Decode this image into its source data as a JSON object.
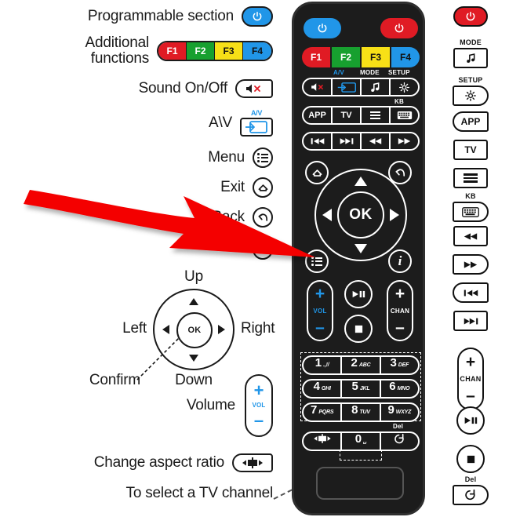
{
  "page": {
    "title": "Universal remote control button guide",
    "background": "#ffffff"
  },
  "colors": {
    "blue": "#2196e8",
    "red": "#e01b24",
    "green": "#17a02f",
    "yellow": "#f7e017",
    "remote_body": "#1c1c1c",
    "arrow_red": "#f40000",
    "text": "#1a1a1a"
  },
  "callouts": [
    {
      "label": "Programmable section",
      "icon": "power-icon"
    },
    {
      "label": "Additional functions",
      "label_line1": "Additional",
      "label_line2": "functions",
      "icon": "f-keys-strip"
    },
    {
      "label": "Sound On/Off",
      "icon": "mute-icon"
    },
    {
      "label": "A\\V",
      "icon": "av-input-icon",
      "tag": "A/V"
    },
    {
      "label": "Menu",
      "icon": "menu-list-icon"
    },
    {
      "label": "Exit",
      "icon": "exit-home-icon"
    },
    {
      "label": "Back",
      "icon": "back-arrow-icon"
    },
    {
      "label": "Volume",
      "icon": "volume-rocker"
    },
    {
      "label": "Change aspect ratio",
      "icon": "aspect-ratio-icon"
    },
    {
      "label": "To select a TV channel",
      "icon": "dashed-leader"
    }
  ],
  "function_keys": [
    {
      "label": "F1",
      "color": "#e01b24"
    },
    {
      "label": "F2",
      "color": "#17a02f"
    },
    {
      "label": "F3",
      "color": "#f7e017"
    },
    {
      "label": "F4",
      "color": "#2196e8"
    }
  ],
  "dpad_diagram": {
    "up": "Up",
    "down": "Down",
    "left": "Left",
    "right": "Right",
    "center": "OK",
    "confirm": "Confirm"
  },
  "volume_rocker": {
    "plus": "+",
    "label": "VOL",
    "minus": "–"
  },
  "remote": {
    "power_left": "power-icon",
    "power_right": "power-icon",
    "function_row": [
      "F1",
      "F2",
      "F3",
      "F4"
    ],
    "row_mute_av": {
      "tags": {
        "av": "A/V",
        "mode": "MODE",
        "setup": "SETUP"
      },
      "keys": [
        "mute-icon",
        "av-input-icon",
        "music-note-icon",
        "gear-icon"
      ]
    },
    "row_app": {
      "tags": {
        "kb": "KB"
      },
      "keys": [
        "APP",
        "TV",
        "hamburger-icon",
        "keyboard-icon"
      ]
    },
    "row_transport": [
      "skip-back-icon",
      "skip-forward-icon",
      "rewind-icon",
      "fast-forward-icon"
    ],
    "nav": {
      "home": "exit-home-icon",
      "back": "back-arrow-icon",
      "menu": "menu-list-icon",
      "info": "info-icon",
      "ok": "OK"
    },
    "vol": {
      "plus": "+",
      "label": "VOL",
      "minus": "–"
    },
    "chan": {
      "plus": "+",
      "label": "CHAN",
      "minus": "–"
    },
    "playpause": "play-pause-icon",
    "stop": "stop-icon",
    "keypad": [
      {
        "num": "1",
        "sub": ".,!/"
      },
      {
        "num": "2",
        "sub": "ABC"
      },
      {
        "num": "3",
        "sub": "DEF"
      },
      {
        "num": "4",
        "sub": "GHI"
      },
      {
        "num": "5",
        "sub": "JKL"
      },
      {
        "num": "6",
        "sub": "MNO"
      },
      {
        "num": "7",
        "sub": "PQRS"
      },
      {
        "num": "8",
        "sub": "TUV"
      },
      {
        "num": "9",
        "sub": "WXYZ"
      }
    ],
    "keypad_bottom": {
      "aspect": "aspect-ratio-icon",
      "zero": "0",
      "zero_sub": "␣",
      "del_tag": "Del",
      "del": "loop-back-icon"
    }
  },
  "right_column": [
    {
      "name": "power-button",
      "icon": "power-icon",
      "tag": "",
      "shape": "pill-red"
    },
    {
      "name": "mode-button",
      "icon": "music-note-icon",
      "tag": "MODE",
      "shape": "square"
    },
    {
      "name": "setup-button",
      "icon": "gear-icon",
      "tag": "SETUP",
      "shape": "pill-right"
    },
    {
      "name": "app-button",
      "icon": "APP",
      "tag": "",
      "shape": "pill-left"
    },
    {
      "name": "tv-button",
      "icon": "TV",
      "tag": "",
      "shape": "square"
    },
    {
      "name": "menu-button",
      "icon": "hamburger-icon",
      "tag": "",
      "shape": "square"
    },
    {
      "name": "keyboard-button",
      "icon": "keyboard-icon",
      "tag": "KB",
      "shape": "pill-right"
    },
    {
      "name": "rewind-button",
      "icon": "rewind-icon",
      "tag": "",
      "shape": "square"
    },
    {
      "name": "fast-forward-button",
      "icon": "fast-forward-icon",
      "tag": "",
      "shape": "pill-right"
    },
    {
      "name": "skip-back-button",
      "icon": "skip-back-icon",
      "tag": "",
      "shape": "pill-left"
    },
    {
      "name": "skip-forward-button",
      "icon": "skip-forward-icon",
      "tag": "",
      "shape": "square"
    },
    {
      "name": "channel-rocker",
      "icon": "chan-rocker",
      "tag": "",
      "shape": "rocker"
    },
    {
      "name": "play-pause-button",
      "icon": "play-pause-icon",
      "tag": "",
      "shape": "circle"
    },
    {
      "name": "stop-button",
      "icon": "stop-icon",
      "tag": "",
      "shape": "circle"
    },
    {
      "name": "del-button",
      "icon": "loop-back-icon",
      "tag": "Del",
      "shape": "pill-right"
    }
  ],
  "right_chan": {
    "plus": "+",
    "label": "CHAN",
    "minus": "–"
  },
  "annotation": {
    "arrow_color": "#f40000",
    "arrow_points_to": "menu-list-button-on-remote"
  }
}
